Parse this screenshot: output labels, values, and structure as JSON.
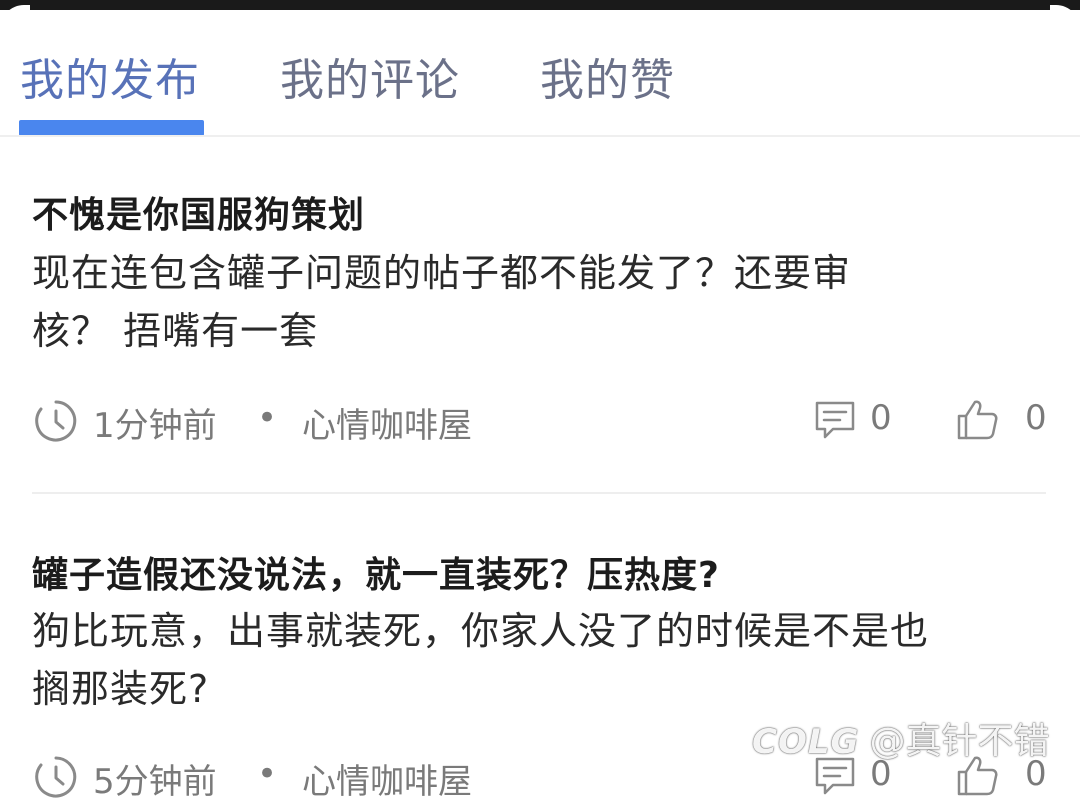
{
  "tabs": [
    {
      "label": "我的发布",
      "active": true
    },
    {
      "label": "我的评论",
      "active": false
    },
    {
      "label": "我的赞",
      "active": false
    }
  ],
  "colors": {
    "active_tab": "#5872b8",
    "inactive_tab": "#6b7189",
    "indicator": "#4a86ee"
  },
  "posts": [
    {
      "title": "不愧是你国服狗策划",
      "body_lines": [
        "现在连包含罐子问题的帖子都不能发了？还要审",
        "核？  捂嘴有一套"
      ],
      "time": "1分钟前",
      "separator": "•",
      "board": "心情咖啡屋",
      "comments": "0",
      "likes": "0"
    },
    {
      "title": "罐子造假还没说法，就一直装死？压热度?",
      "body_lines": [
        "狗比玩意，出事就装死，你家人没了的时候是不是也",
        "搁那装死?"
      ],
      "time": "5分钟前",
      "separator": "•",
      "board": "心情咖啡屋",
      "comments": "0",
      "likes": "0"
    }
  ],
  "watermark": {
    "logo": "COLG",
    "text": "@真针不错"
  },
  "icons": [
    "clock-icon",
    "comment-icon",
    "thumbs-up-icon"
  ]
}
